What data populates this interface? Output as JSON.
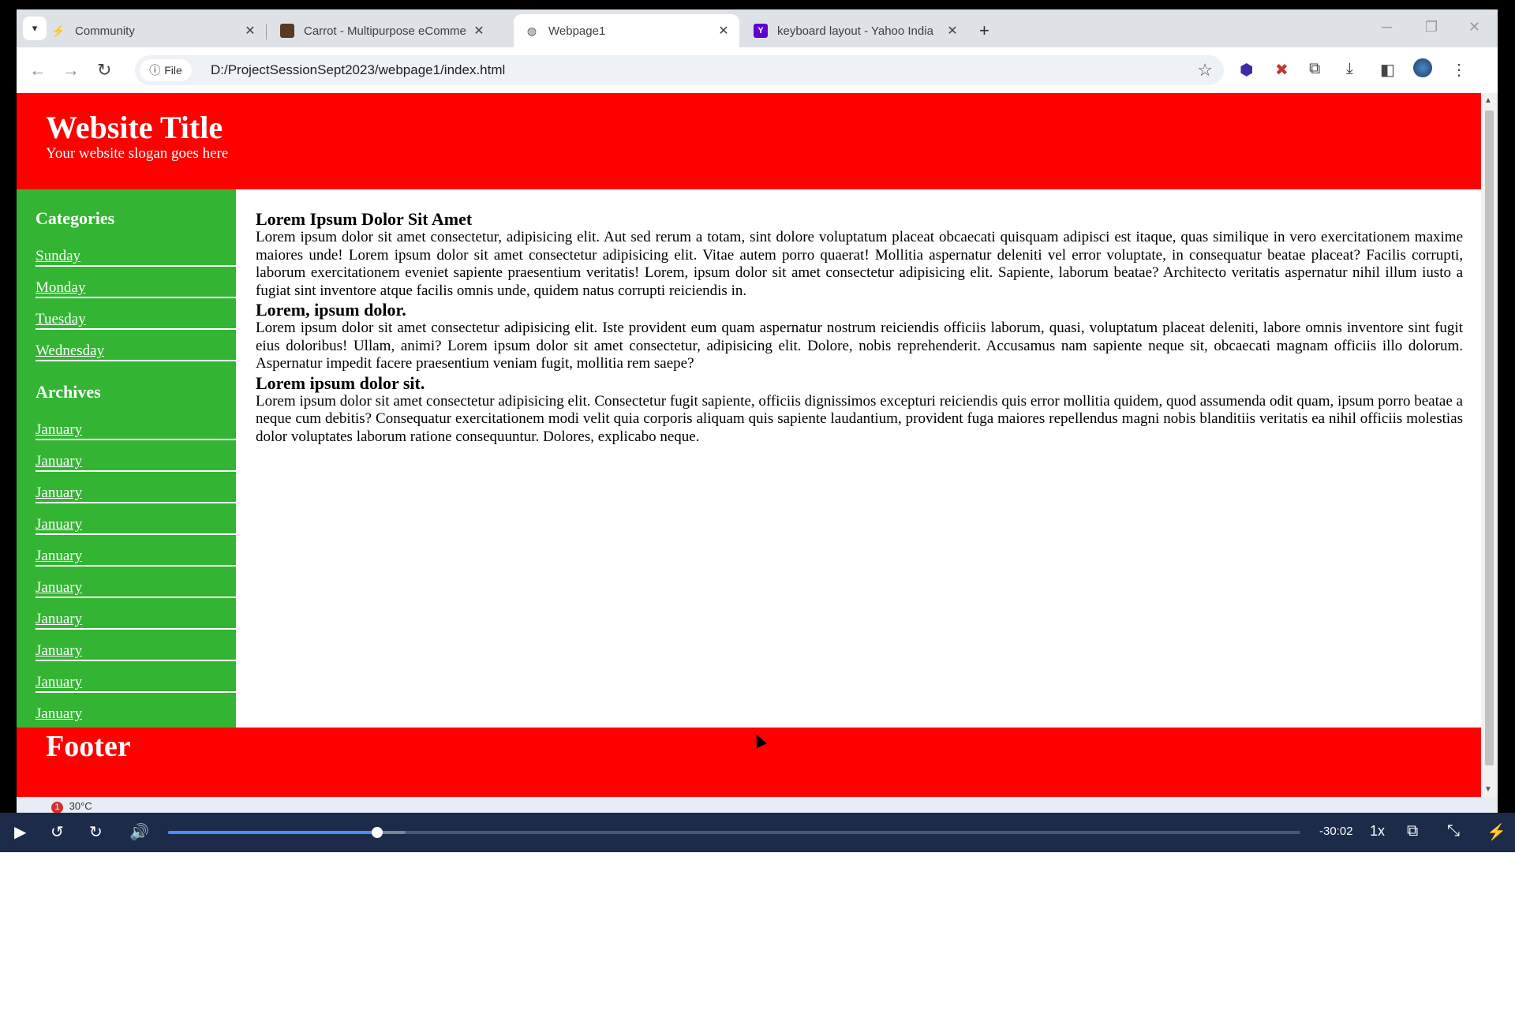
{
  "browser": {
    "tabs": [
      {
        "title": "Community",
        "icon": "community-icon"
      },
      {
        "title": "Carrot - Multipurpose eComme",
        "icon": "carrot-icon"
      },
      {
        "title": "Webpage1",
        "icon": "globe-icon",
        "active": true
      },
      {
        "title": "keyboard layout - Yahoo India",
        "icon": "yahoo-icon"
      }
    ],
    "address_chip": "File",
    "url": "D:/ProjectSessionSept2023/webpage1/index.html"
  },
  "site": {
    "title": "Website Title",
    "slogan": "Your website slogan goes here",
    "sidebar": {
      "categories_heading": "Categories",
      "categories": [
        "Sunday",
        "Monday",
        "Tuesday",
        "Wednesday"
      ],
      "archives_heading": "Archives",
      "archives": [
        "January",
        "January",
        "January",
        "January",
        "January",
        "January",
        "January",
        "January",
        "January",
        "January"
      ]
    },
    "content": [
      {
        "heading": "Lorem Ipsum Dolor Sit Amet",
        "body": "Lorem ipsum dolor sit amet consectetur, adipisicing elit. Aut sed rerum a totam, sint dolore voluptatum placeat obcaecati quisquam adipisci est itaque, quas similique in vero exercitationem maxime maiores unde! Lorem ipsum dolor sit amet consectetur adipisicing elit. Vitae autem porro quaerat! Mollitia aspernatur deleniti vel error voluptate, in consequatur beatae placeat? Facilis corrupti, laborum exercitationem eveniet sapiente praesentium veritatis! Lorem, ipsum dolor sit amet consectetur adipisicing elit. Sapiente, laborum beatae? Architecto veritatis aspernatur nihil illum iusto a fugiat sint inventore atque facilis omnis unde, quidem natus corrupti reiciendis in."
      },
      {
        "heading": "Lorem, ipsum dolor.",
        "body": "Lorem ipsum dolor sit amet consectetur adipisicing elit. Iste provident eum quam aspernatur nostrum reiciendis officiis laborum, quasi, voluptatum placeat deleniti, labore omnis inventore sint fugit eius doloribus! Ullam, animi? Lorem ipsum dolor sit amet consectetur, adipisicing elit. Dolore, nobis reprehenderit. Accusamus nam sapiente neque sit, obcaecati magnam officiis illo dolorum. Aspernatur impedit facere praesentium veniam fugit, mollitia rem saepe?"
      },
      {
        "heading": "Lorem ipsum dolor sit.",
        "body": "Lorem ipsum dolor sit amet consectetur adipisicing elit. Consectetur fugit sapiente, officiis dignissimos excepturi reiciendis quis error mollitia quidem, quod assumenda odit quam, ipsum porro beatae a neque cum debitis? Consequatur exercitationem modi velit quia corporis aliquam quis sapiente laudantium, provident fuga maiores repellendus magni nobis blanditiis veritatis ea nihil officiis molestias dolor voluptates laborum ratione consequuntur. Dolores, explicabo neque."
      }
    ],
    "footer": "Footer"
  },
  "taskbar": {
    "weather_badge": "1",
    "temperature": "30°C"
  },
  "player": {
    "time_remaining": "-30:02",
    "speed": "1x",
    "progress": 0.185,
    "buffered": 0.21
  },
  "colors": {
    "header": "#ff0000",
    "sidebar": "#33b533",
    "player": "#1c2b4a",
    "progress": "#4a8ef5"
  }
}
